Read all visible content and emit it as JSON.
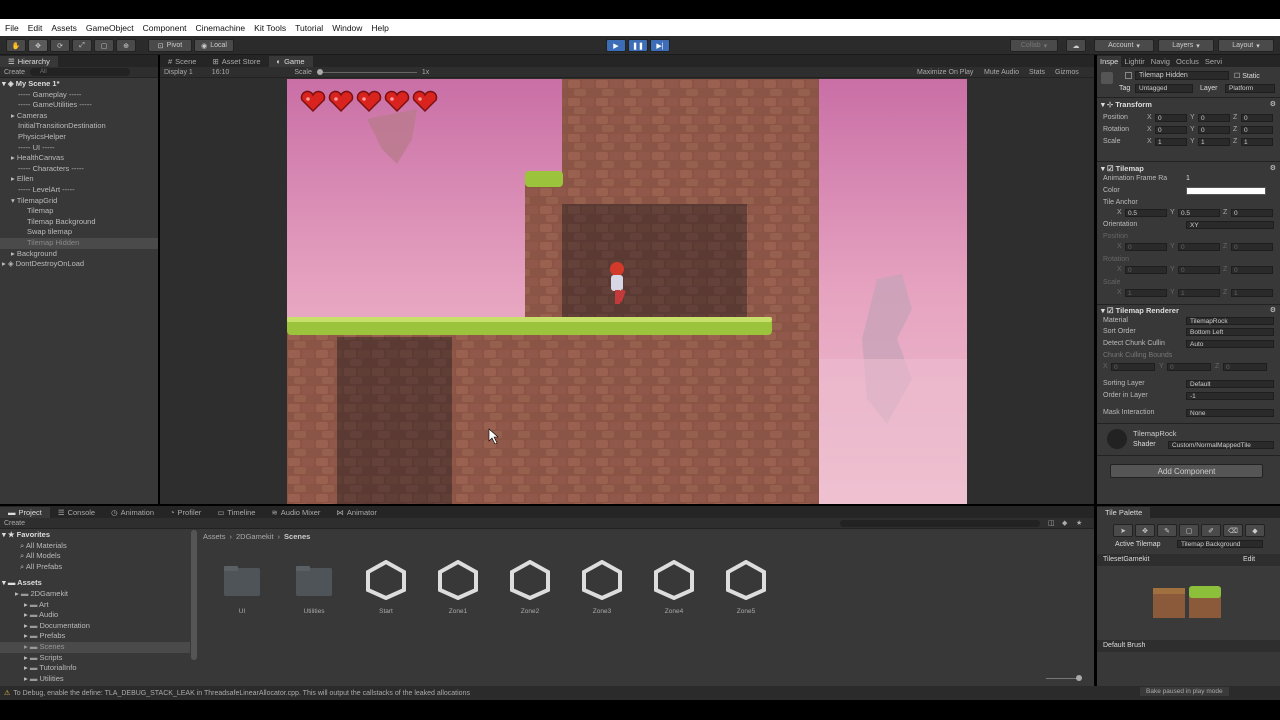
{
  "menu": [
    "File",
    "Edit",
    "Assets",
    "GameObject",
    "Component",
    "Cinemachine",
    "Kit Tools",
    "Tutorial",
    "Window",
    "Help"
  ],
  "toolbar": {
    "pivot": "Pivot",
    "local": "Local",
    "collab": "Collab",
    "account": "Account",
    "layers": "Layers",
    "layout": "Layout"
  },
  "hierarchy": {
    "tab": "Hierarchy",
    "create": "Create",
    "search_placeholder": "All",
    "scene": "My Scene 1*",
    "items": [
      {
        "label": "----- Gameplay -----",
        "indent": 1
      },
      {
        "label": "----- GameUtilities -----",
        "indent": 1
      },
      {
        "label": "Cameras",
        "indent": 1,
        "arrow": true
      },
      {
        "label": "InitialTransitionDestination",
        "indent": 1
      },
      {
        "label": "PhysicsHelper",
        "indent": 1
      },
      {
        "label": "----- UI -----",
        "indent": 1
      },
      {
        "label": "HealthCanvas",
        "indent": 1,
        "arrow": true
      },
      {
        "label": "----- Characters -----",
        "indent": 1
      },
      {
        "label": "Ellen",
        "indent": 1,
        "arrow": true
      },
      {
        "label": "----- LevelArt -----",
        "indent": 1
      },
      {
        "label": "TilemapGrid",
        "indent": 1,
        "arrow": true,
        "open": true
      },
      {
        "label": "Tilemap",
        "indent": 2
      },
      {
        "label": "Tilemap Background",
        "indent": 2
      },
      {
        "label": "Swap tilemap",
        "indent": 2
      },
      {
        "label": "Tilemap Hidden",
        "indent": 2,
        "selected": true
      },
      {
        "label": "Background",
        "indent": 1,
        "arrow": true
      }
    ],
    "dontdestroy": "DontDestroyOnLoad"
  },
  "view_tabs": {
    "scene": "Scene",
    "asset_store": "Asset Store",
    "game": "Game",
    "display": "Display 1",
    "aspect": "16:10",
    "scale_label": "Scale",
    "scale_value": "1x",
    "maximize": "Maximize On Play",
    "mute": "Mute Audio",
    "stats": "Stats",
    "gizmos": "Gizmos"
  },
  "inspector": {
    "tabs": [
      "Inspe",
      "Lightir",
      "Navig",
      "Occlus",
      "Servi"
    ],
    "object_name": "Tilemap Hidden",
    "static": "Static",
    "tag_label": "Tag",
    "tag_value": "Untagged",
    "layer_label": "Layer",
    "layer_value": "Platform",
    "transform": {
      "header": "Transform",
      "position_label": "Position",
      "rotation_label": "Rotation",
      "scale_label": "Scale",
      "position": [
        "0",
        "0",
        "0"
      ],
      "rotation": [
        "0",
        "0",
        "0"
      ],
      "scale": [
        "1",
        "1",
        "1"
      ]
    },
    "tilemap": {
      "header": "Tilemap",
      "anim_rate_label": "Animation Frame Ra",
      "anim_rate": "1",
      "color_label": "Color",
      "anchor_label": "Tile Anchor",
      "anchor": [
        "0.5",
        "0.5",
        "0"
      ],
      "orientation_label": "Orientation",
      "orientation": "XY",
      "dim_position_label": "Position",
      "dim_rotation_label": "Rotation",
      "dim_scale_label": "Scale",
      "dim_values": [
        [
          "0",
          "0",
          "0"
        ],
        [
          "0",
          "0",
          "0"
        ],
        [
          "1",
          "1",
          "1"
        ]
      ]
    },
    "renderer": {
      "header": "Tilemap Renderer",
      "material_label": "Material",
      "material": "TilemapRock",
      "sort_label": "Sort Order",
      "sort": "Bottom Left",
      "chunk_label": "Detect Chunk Cullin",
      "chunk": "Auto",
      "bounds_label": "Chunk Culling Bounds",
      "bounds": [
        "0",
        "0",
        "0"
      ],
      "sorting_layer_label": "Sorting Layer",
      "sorting_layer": "Default",
      "order_label": "Order in Layer",
      "order": "-1",
      "mask_label": "Mask Interaction",
      "mask": "None"
    },
    "material": {
      "name": "TilemapRock",
      "shader_label": "Shader",
      "shader": "Custom/NormalMappedTile"
    },
    "add_component": "Add Component"
  },
  "project": {
    "tabs": [
      "Project",
      "Console",
      "Animation",
      "Profiler",
      "Timeline",
      "Audio Mixer",
      "Animator"
    ],
    "create": "Create",
    "favorites": "Favorites",
    "fav_items": [
      "All Materials",
      "All Models",
      "All Prefabs"
    ],
    "assets": "Assets",
    "tree": [
      {
        "label": "2DGamekit",
        "indent": 1
      },
      {
        "label": "Art",
        "indent": 2
      },
      {
        "label": "Audio",
        "indent": 2
      },
      {
        "label": "Documentation",
        "indent": 2
      },
      {
        "label": "Prefabs",
        "indent": 2
      },
      {
        "label": "Scenes",
        "indent": 2,
        "selected": true
      },
      {
        "label": "Scripts",
        "indent": 2
      },
      {
        "label": "TutorialInfo",
        "indent": 2
      },
      {
        "label": "Utilities",
        "indent": 2
      }
    ],
    "breadcrumb": [
      "Assets",
      "2DGamekit",
      "Scenes"
    ],
    "files": [
      {
        "name": "UI",
        "kind": "folder"
      },
      {
        "name": "Utilities",
        "kind": "folder"
      },
      {
        "name": "Start",
        "kind": "unity"
      },
      {
        "name": "Zone1",
        "kind": "unity"
      },
      {
        "name": "Zone2",
        "kind": "unity"
      },
      {
        "name": "Zone3",
        "kind": "unity"
      },
      {
        "name": "Zone4",
        "kind": "unity"
      },
      {
        "name": "Zone5",
        "kind": "unity"
      }
    ]
  },
  "palette": {
    "tab": "Tile Palette",
    "active_label": "Active Tilemap",
    "active_value": "Tilemap Background",
    "palette_name": "TilesetGamekit",
    "edit": "Edit",
    "brush": "Default Brush"
  },
  "status": {
    "message": "To Debug, enable the define: TLA_DEBUG_STACK_LEAK in ThreadsafeLinearAllocator.cpp. This will output the callstacks of the leaked allocations",
    "bake": "Bake paused in play mode"
  },
  "game": {
    "hearts": 5
  },
  "colors": {
    "play": "#3e6db8",
    "panel": "#383838",
    "sky": "#d98fb0",
    "rock": "#8a5446",
    "grass": "#9bc43c"
  }
}
